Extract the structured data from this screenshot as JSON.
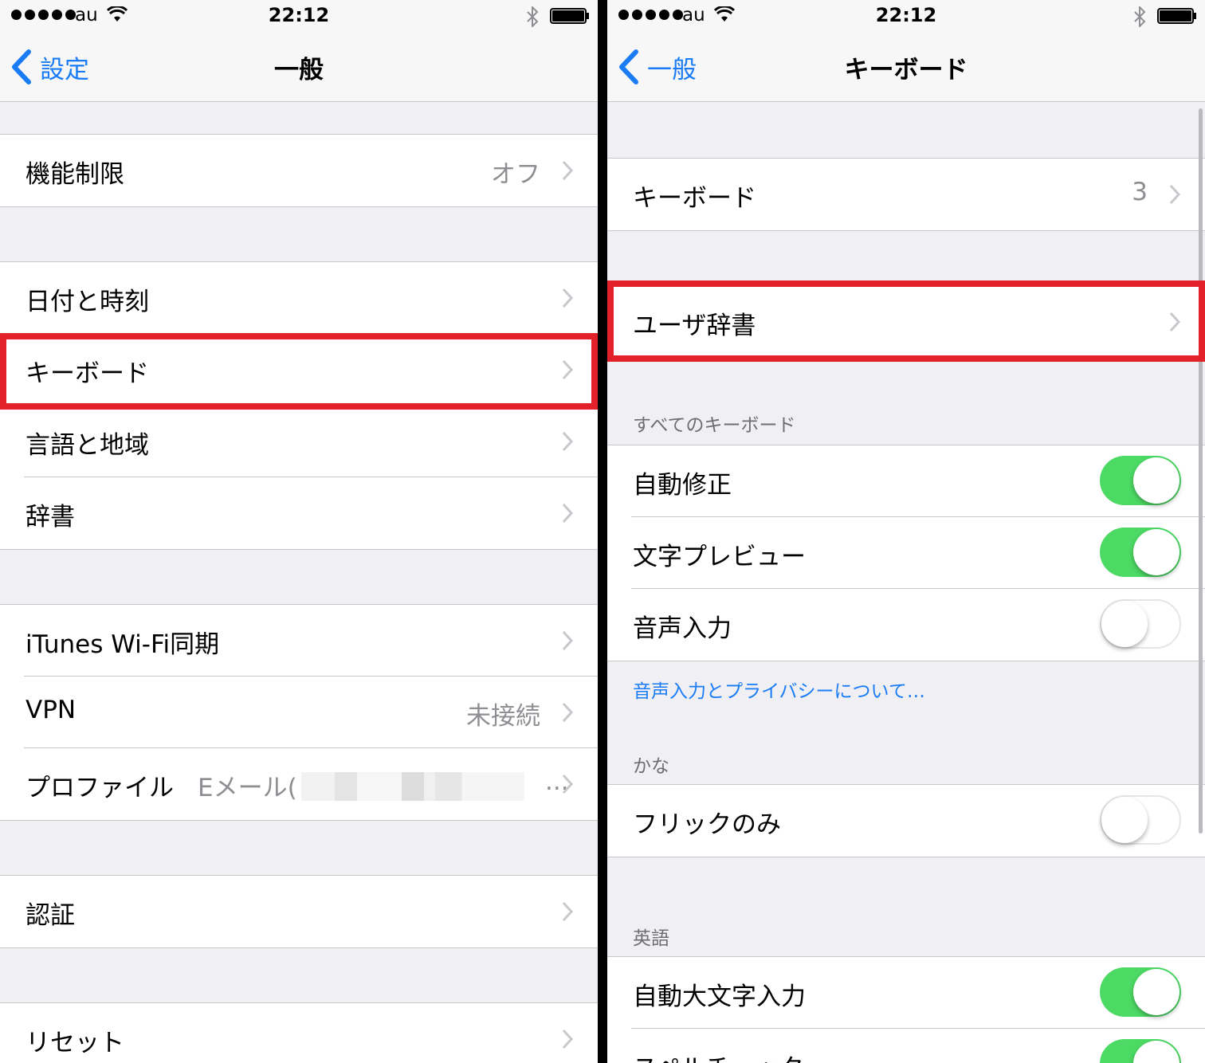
{
  "status_bar": {
    "carrier": "au",
    "time": "22:12"
  },
  "left": {
    "nav": {
      "back_label": "設定",
      "title": "一般"
    },
    "rows": {
      "restrictions": {
        "label": "機能制限",
        "value": "オフ"
      },
      "date_time": {
        "label": "日付と時刻"
      },
      "keyboard": {
        "label": "キーボード"
      },
      "language_region": {
        "label": "言語と地域"
      },
      "dictionary": {
        "label": "辞書"
      },
      "itunes_wifi_sync": {
        "label": "iTunes Wi-Fi同期"
      },
      "vpn": {
        "label": "VPN",
        "value": "未接続"
      },
      "profile": {
        "label": "プロファイル",
        "value": "Eメール(",
        "ellipsis": "..."
      },
      "certification": {
        "label": "認証"
      },
      "reset": {
        "label": "リセット"
      }
    }
  },
  "right": {
    "nav": {
      "back_label": "一般",
      "title": "キーボード"
    },
    "rows": {
      "keyboards": {
        "label": "キーボード",
        "value": "3"
      },
      "user_dictionary": {
        "label": "ユーザ辞書"
      }
    },
    "sections": {
      "all_keyboards": {
        "header": "すべてのキーボード",
        "auto_correction": {
          "label": "自動修正",
          "on": true
        },
        "character_preview": {
          "label": "文字プレビュー",
          "on": true
        },
        "dictation": {
          "label": "音声入力",
          "on": false
        },
        "footer_link": "音声入力とプライバシーについて…"
      },
      "kana": {
        "header": "かな",
        "flick_only": {
          "label": "フリックのみ",
          "on": false
        }
      },
      "english": {
        "header": "英語",
        "auto_capitalization": {
          "label": "自動大文字入力",
          "on": true
        },
        "spell_check": {
          "label": "スペルチェック",
          "on": true
        }
      }
    }
  },
  "colors": {
    "accent": "#1a7cf5",
    "switch_on": "#4cd964",
    "highlight": "#e2212b",
    "background": "#efeff4"
  }
}
